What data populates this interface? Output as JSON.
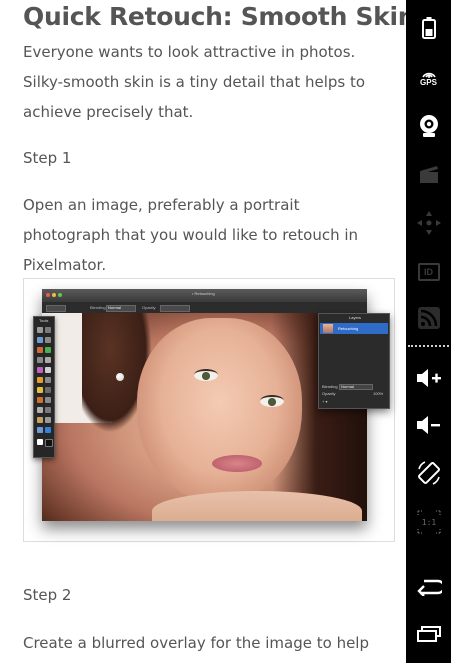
{
  "article": {
    "title": "Quick Retouch: Smooth Skin",
    "intro": "Everyone wants to look attractive in photos. Silky-smooth skin is a tiny detail that helps to achieve precisely that.",
    "step1_heading": "Step 1",
    "step1_text": "Open an image, preferably a portrait photograph that you would like to retouch in Pixelmator.",
    "step2_heading": "Step 2",
    "step2_text": "Create a blurred overlay for the image to help"
  },
  "figure": {
    "window_title": "• Retouching",
    "option_blending_label": "Blending",
    "option_blending_value": "Normal",
    "option_opacity_label": "Opacity",
    "tools_title": "Tools",
    "layers_title": "Layers",
    "layer_name": "Retouching",
    "layers_blending_label": "Blending",
    "layers_blending_value": "Normal",
    "layers_opacity_label": "Opacity",
    "layers_opacity_value": "100%"
  },
  "navbar": {
    "gps_label": "GPS",
    "id_label": "ID",
    "ratio_label": "1:1",
    "icons": [
      "battery-icon",
      "gps-icon",
      "webcam-icon",
      "clapperboard-icon",
      "dpad-icon",
      "id-icon",
      "rss-icon",
      "volume-up-icon",
      "volume-down-icon",
      "rotate-screen-icon",
      "aspect-ratio-icon",
      "back-icon",
      "recent-apps-icon"
    ]
  },
  "colors": {
    "text": "#555555",
    "navbar_bg": "#000000",
    "nav_icon_active": "#ffffff",
    "nav_icon_dim": "#3a3a3a"
  }
}
